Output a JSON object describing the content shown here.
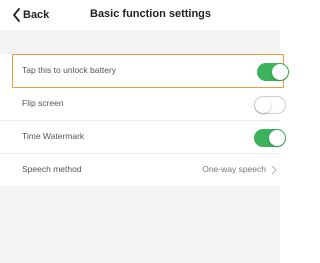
{
  "header": {
    "back_label": "Back",
    "title": "Basic function settings"
  },
  "settings": [
    {
      "label": "Tap this to unlock battery",
      "control": "toggle",
      "enabled": true,
      "highlighted": true
    },
    {
      "label": "Flip screen",
      "control": "toggle",
      "enabled": false
    },
    {
      "label": "Time Watermark",
      "control": "toggle",
      "enabled": true
    },
    {
      "label": "Speech method",
      "control": "select",
      "value": "One-way speech"
    }
  ],
  "colors": {
    "toggle_on": "#3cb35a",
    "highlight_border": "#f59a3b",
    "background_gray": "#f3f3f5"
  }
}
